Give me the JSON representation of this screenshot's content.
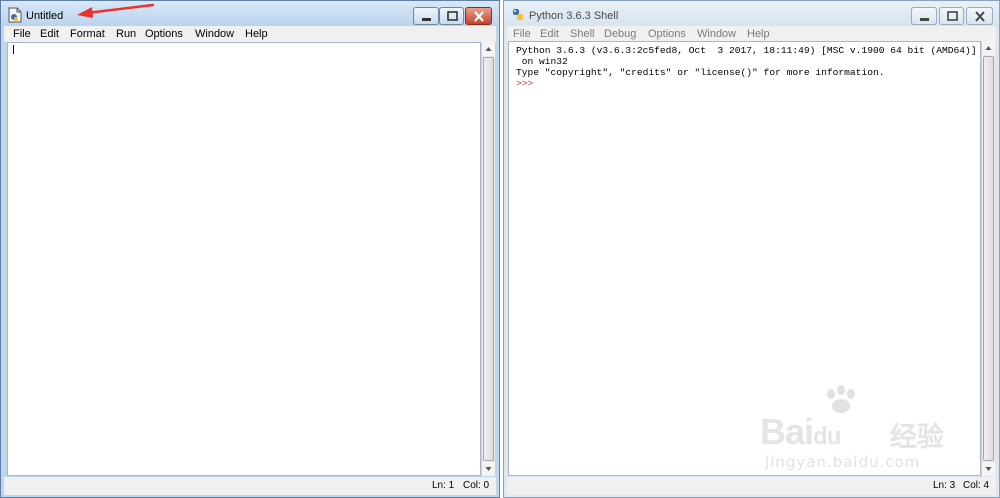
{
  "left_window": {
    "title": "Untitled",
    "menu": [
      "File",
      "Edit",
      "Format",
      "Run",
      "Options",
      "Window",
      "Help"
    ],
    "status": {
      "line": "Ln: 1",
      "col": "Col: 0"
    }
  },
  "right_window": {
    "title": "Python 3.6.3 Shell",
    "menu": [
      "File",
      "Edit",
      "Shell",
      "Debug",
      "Options",
      "Window",
      "Help"
    ],
    "shell_lines": [
      "Python 3.6.3 (v3.6.3:2c5fed8, Oct  3 2017, 18:11:49) [MSC v.1900 64 bit (AMD64)]",
      " on win32",
      "Type \"copyright\", \"credits\" or \"license()\" for more information."
    ],
    "prompt": ">>>",
    "status": {
      "line": "Ln: 3",
      "col": "Col: 4"
    }
  },
  "watermark": {
    "brand": "Bai",
    "brand_suffix": "du",
    "brand_cn": "经验",
    "url": "jingyan.baidu.com"
  },
  "colors": {
    "annotation_arrow": "#e8322a",
    "prompt": "#c03030",
    "close_button": "#c7452d"
  }
}
